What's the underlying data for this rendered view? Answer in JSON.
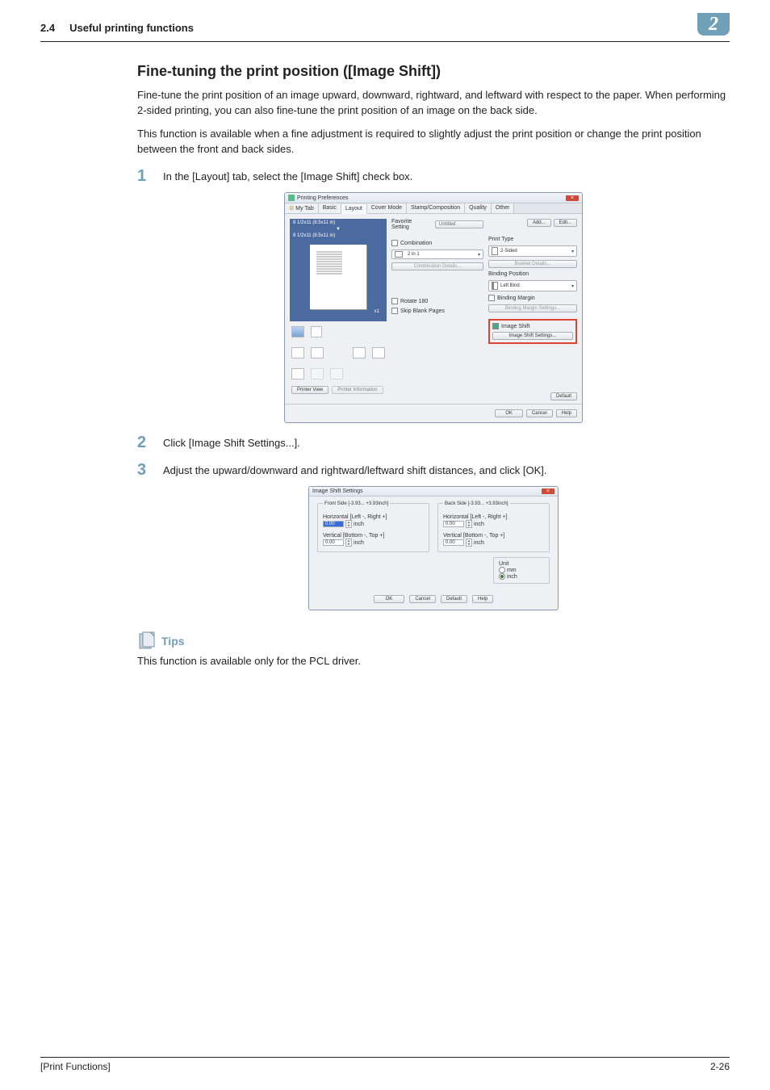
{
  "header": {
    "section_no": "2.4",
    "section_title": "Useful printing functions",
    "chapter_badge": "2"
  },
  "section": {
    "title": "Fine-tuning the print position ([Image Shift])",
    "para1": "Fine-tune the print position of an image upward, downward, rightward, and leftward with respect to the paper. When performing 2-sided printing, you can also fine-tune the print position of an image on the back side.",
    "para2": "This function is available when a fine adjustment is required to slightly adjust the print position or change the print position between the front and back sides."
  },
  "steps": {
    "s1": {
      "num": "1",
      "text": "In the [Layout] tab, select the [Image Shift] check box."
    },
    "s2": {
      "num": "2",
      "text": "Click [Image Shift Settings...]."
    },
    "s3": {
      "num": "3",
      "text": "Adjust the upward/downward and rightward/leftward shift distances, and click [OK]."
    }
  },
  "dialog1": {
    "title": "Printing Preferences",
    "close": "×",
    "tabs": {
      "mytab": "My Tab",
      "basic": "Basic",
      "layout": "Layout",
      "cover": "Cover Mode",
      "stamp": "Stamp/Composition",
      "quality": "Quality",
      "other": "Other"
    },
    "preview": {
      "top": "8 1/2x11 (8.5x11 in)",
      "bot": "8 1/2x11 (8.5x11 in)",
      "x1": "x1"
    },
    "left_buttons": {
      "printer_view": "Printer View",
      "printer_info": "Printer Information"
    },
    "mid": {
      "fav_label": "Favorite Setting",
      "fav_value": "Untitled",
      "combination": "Combination",
      "twoin1": "2 in 1",
      "comb_details": "Combination Details...",
      "rotate": "Rotate 180",
      "skip": "Skip Blank Pages"
    },
    "right": {
      "add": "Add...",
      "edit": "Edit...",
      "print_type_label": "Print Type",
      "print_type_value": "2-Sided",
      "booklet": "Booklet Details...",
      "bind_label": "Binding Position",
      "bind_value": "Left Bind",
      "margin": "Binding Margin",
      "margin_btn": "Binding Margin Settings...",
      "imgshift": "Image Shift",
      "imgshift_btn": "Image Shift Settings...",
      "default": "Default"
    },
    "footer": {
      "ok": "OK",
      "cancel": "Cancel",
      "help": "Help"
    }
  },
  "dialog2": {
    "title": "Image Shift Settings",
    "front": {
      "legend": "Front Side [-3.93... +3.93inch]",
      "hz_label": "Horizontal [Left -, Right +]",
      "hz_val": "0.00",
      "vt_label": "Vertical [Bottom -, Top +]",
      "vt_val": "0.00",
      "unit": "inch"
    },
    "back": {
      "legend": "Back Side [-3.93... +3.93inch]",
      "hz_label": "Horizontal [Left -, Right +]",
      "hz_val": "0.00",
      "vt_label": "Vertical [Bottom -, Top +]",
      "vt_val": "0.00",
      "unit": "inch"
    },
    "unitgroup": {
      "legend": "Unit",
      "mm": "mm",
      "inch": "inch"
    },
    "footer": {
      "ok": "OK",
      "cancel": "Cancel",
      "default": "Default",
      "help": "Help"
    }
  },
  "tips": {
    "label": "Tips",
    "text": "This function is available only for the PCL driver."
  },
  "footer": {
    "left": "[Print Functions]",
    "right": "2-26"
  }
}
